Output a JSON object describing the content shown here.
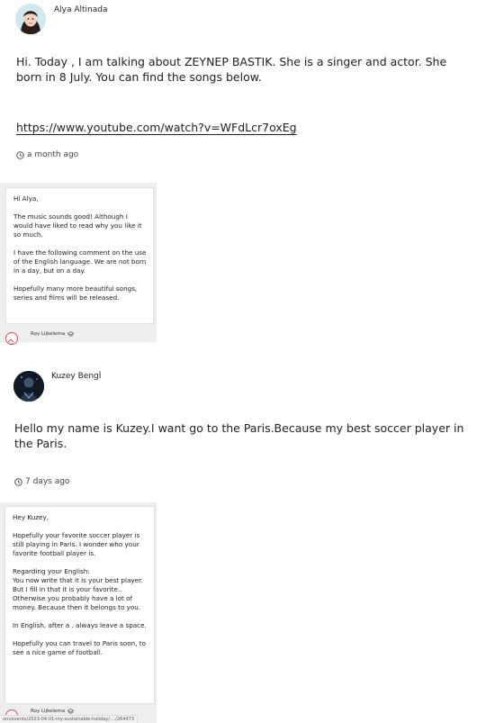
{
  "posts": [
    {
      "author": "Alya Altinada",
      "body": "Hi. Today , I am talking about ZEYNEP BASTIK. She is a singer and actor. She born in 8 July. You can find the songs below.",
      "link": "https://www.youtube.com/watch?v=WFdLcr7oxEg",
      "time": "a month ago",
      "reply": {
        "paragraphs": [
          "Hi Alya,",
          "The music sounds good! Although I would have liked to read why you like it so much.",
          "I have the following comment on the use of the English language. We are not born in a day, but on a day.",
          "Hopefully many more beautiful songs, series and films will be released."
        ],
        "author": "Roy Lijkelema"
      }
    },
    {
      "author": "Kuzey Bengİ",
      "body": "Hello my name is Kuzey.I want go to the Paris.Because my best soccer player in the Paris.",
      "time": "7 days ago",
      "reply": {
        "paragraphs": [
          "Hey Kuzey,",
          "Hopefully your favorite soccer player is still playing in Paris. I wonder who your favorite football player is.",
          "Regarding your English:\nYou now write that it is your best player. But I fill in that it is your favorite.. Otherwise you probably have a lot of money. Because then it belongs to you.",
          "In English, after a . always leave a space.",
          "Hopefully you can travel to Paris soon, to see a nice game of football."
        ],
        "author": "Roy Lijkelema"
      }
    }
  ],
  "status_url": "om/events/2023-04-01-my-sustainable-holiday/..../264473",
  "icons": {
    "clock": "clock-icon",
    "role": "graduation-cap-icon"
  },
  "colors": {
    "panel": "#eeeeee",
    "avatar_ring": "#e04a5a"
  }
}
